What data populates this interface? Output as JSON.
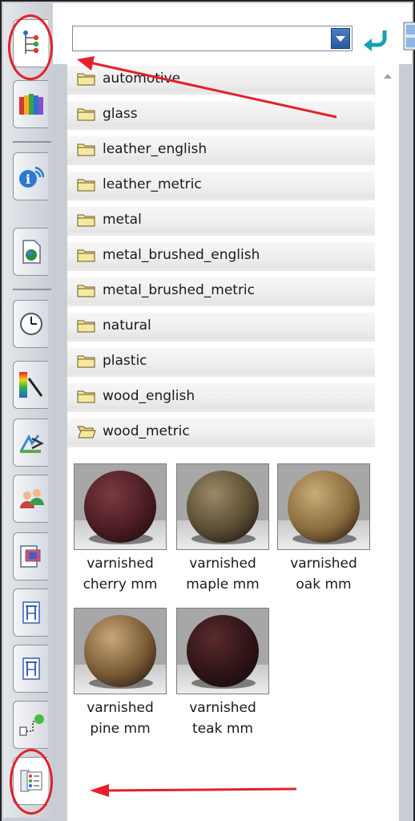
{
  "toolbar": {
    "combo_value": "",
    "combo_dropdown_icon": "chevron-down-icon",
    "back_icon": "back-arrow-icon",
    "view_icon": "view-mode-icon"
  },
  "sidebar": {
    "tabs": [
      {
        "name": "tab-feature-tree",
        "icon": "feature-tree-icon"
      },
      {
        "name": "tab-library",
        "icon": "library-books-icon"
      },
      {
        "name": "tab-info",
        "icon": "info-icon"
      },
      {
        "name": "tab-document",
        "icon": "document-icon"
      },
      {
        "name": "tab-history",
        "icon": "clock-icon"
      },
      {
        "name": "tab-color",
        "icon": "color-palette-icon"
      },
      {
        "name": "tab-tools",
        "icon": "tools-icon"
      },
      {
        "name": "tab-users",
        "icon": "users-icon"
      },
      {
        "name": "tab-drawing",
        "icon": "drawing-icon"
      },
      {
        "name": "tab-frame-1",
        "icon": "frame-icon"
      },
      {
        "name": "tab-frame-2",
        "icon": "frame-icon"
      },
      {
        "name": "tab-route",
        "icon": "route-icon"
      },
      {
        "name": "tab-materials",
        "icon": "materials-list-icon"
      }
    ]
  },
  "folders": [
    {
      "label": "automotive",
      "open": false
    },
    {
      "label": "glass",
      "open": false
    },
    {
      "label": "leather_english",
      "open": false
    },
    {
      "label": "leather_metric",
      "open": false
    },
    {
      "label": "metal",
      "open": false
    },
    {
      "label": "metal_brushed_english",
      "open": false
    },
    {
      "label": "metal_brushed_metric",
      "open": false
    },
    {
      "label": "natural",
      "open": false
    },
    {
      "label": "plastic",
      "open": false
    },
    {
      "label": "wood_english",
      "open": false
    },
    {
      "label": "wood_metric",
      "open": true
    }
  ],
  "materials": [
    {
      "line1": "varnished",
      "line2": "cherry mm",
      "color": "#4a1c22",
      "highlight": "#7a3a40"
    },
    {
      "line1": "varnished",
      "line2": "maple mm",
      "color": "#5b4d34",
      "highlight": "#9a8a66"
    },
    {
      "line1": "varnished",
      "line2": "oak mm",
      "color": "#8a6c3e",
      "highlight": "#c9ac76"
    },
    {
      "line1": "varnished",
      "line2": "pine mm",
      "color": "#7a5a34",
      "highlight": "#c7a77a"
    },
    {
      "line1": "varnished",
      "line2": "teak mm",
      "color": "#2e1416",
      "highlight": "#5a2a2c"
    }
  ],
  "annotations": {
    "color": "#e3202b"
  }
}
